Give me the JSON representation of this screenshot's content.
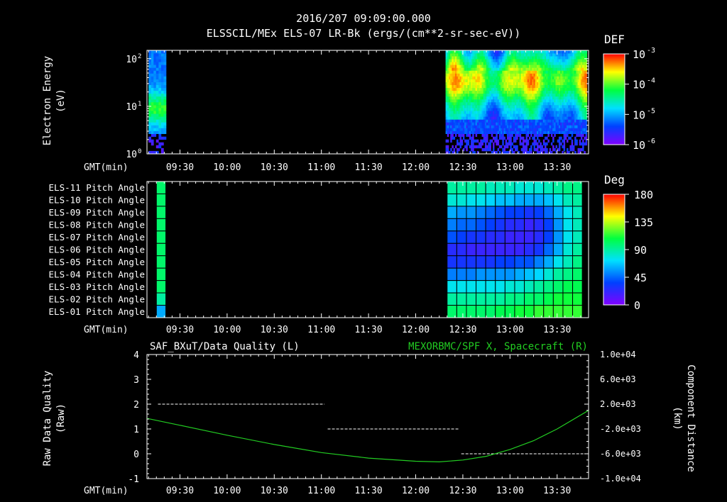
{
  "header": {
    "timestamp": "2016/207 09:09:00.000",
    "title": "ELSSCIL/MEx ELS-07 LR-Bk (ergs/(cm**2-sr-sec-eV))"
  },
  "colors": {
    "background": "#000000",
    "axis": "#ffffff",
    "spacecraft_trace": "#22cc22",
    "quality_trace": "#ffffff"
  },
  "chart_data": [
    {
      "type": "heatmap",
      "name": "electron-energy-spectrogram",
      "ylabel_lines": [
        "Electron Energy",
        "(eV)"
      ],
      "yscale": "log",
      "ylim": [
        1,
        150
      ],
      "ytick_labels": [
        {
          "value": 100,
          "base": "10",
          "exp": "2"
        },
        {
          "value": 10,
          "base": "10",
          "exp": "1"
        },
        {
          "value": 1,
          "base": "10",
          "exp": "0"
        }
      ],
      "x_label": "GMT(min)",
      "x_tick_labels": [
        "09:30",
        "10:00",
        "10:30",
        "11:00",
        "11:30",
        "12:00",
        "12:30",
        "13:00",
        "13:30"
      ],
      "x_tick_minutes": [
        570,
        600,
        630,
        660,
        690,
        720,
        750,
        780,
        810
      ],
      "xlim_minutes": [
        549,
        830
      ],
      "data_segments_minutes": [
        [
          550,
          560
        ],
        [
          739,
          829
        ]
      ],
      "colorbar": {
        "label": "DEF",
        "scale": "log",
        "range": [
          1e-06,
          0.001
        ],
        "tick_labels": [
          {
            "base": "10",
            "exp": "-3",
            "value": 0.001
          },
          {
            "base": "10",
            "exp": "-4",
            "value": 0.0001
          },
          {
            "base": "10",
            "exp": "-5",
            "value": 1e-05
          },
          {
            "base": "10",
            "exp": "-6",
            "value": 1e-06
          }
        ]
      }
    },
    {
      "type": "heatmap",
      "name": "pitch-angle-grid",
      "row_labels": [
        "ELS-11 Pitch Angle",
        "ELS-10 Pitch Angle",
        "ELS-09 Pitch Angle",
        "ELS-08 Pitch Angle",
        "ELS-07 Pitch Angle",
        "ELS-06 Pitch Angle",
        "ELS-05 Pitch Angle",
        "ELS-04 Pitch Angle",
        "ELS-03 Pitch Angle",
        "ELS-02 Pitch Angle",
        "ELS-01 Pitch Angle"
      ],
      "x_label": "GMT(min)",
      "x_tick_labels": [
        "09:30",
        "10:00",
        "10:30",
        "11:00",
        "11:30",
        "12:00",
        "12:30",
        "13:00",
        "13:30"
      ],
      "x_tick_minutes": [
        570,
        600,
        630,
        660,
        690,
        720,
        750,
        780,
        810
      ],
      "xlim_minutes": [
        549,
        830
      ],
      "early_column": {
        "start_minute": 555,
        "end_minute": 561,
        "values_deg": [
          100,
          100,
          100,
          100,
          100,
          100,
          100,
          100,
          100,
          90,
          60
        ]
      },
      "late_block": {
        "start_minute": 740,
        "end_minute": 826,
        "columns": 14,
        "values_deg": [
          [
            90,
            90,
            90,
            90,
            85,
            85,
            85,
            80,
            80,
            80,
            85,
            90,
            95,
            95
          ],
          [
            80,
            80,
            75,
            75,
            70,
            65,
            65,
            60,
            60,
            60,
            65,
            75,
            85,
            90
          ],
          [
            60,
            55,
            55,
            50,
            45,
            40,
            35,
            35,
            30,
            35,
            45,
            60,
            75,
            85
          ],
          [
            50,
            45,
            45,
            40,
            35,
            30,
            25,
            25,
            20,
            25,
            35,
            55,
            75,
            85
          ],
          [
            40,
            35,
            30,
            30,
            25,
            25,
            20,
            20,
            20,
            25,
            35,
            55,
            75,
            85
          ],
          [
            25,
            25,
            20,
            20,
            20,
            20,
            20,
            20,
            25,
            30,
            45,
            60,
            80,
            90
          ],
          [
            30,
            30,
            30,
            30,
            30,
            35,
            35,
            40,
            40,
            50,
            60,
            75,
            85,
            95
          ],
          [
            50,
            50,
            50,
            55,
            55,
            55,
            55,
            60,
            65,
            70,
            80,
            90,
            95,
            100
          ],
          [
            75,
            75,
            75,
            75,
            75,
            75,
            80,
            80,
            85,
            90,
            95,
            100,
            105,
            105
          ],
          [
            90,
            90,
            90,
            90,
            90,
            90,
            95,
            95,
            100,
            100,
            105,
            110,
            110,
            110
          ],
          [
            100,
            100,
            100,
            100,
            100,
            105,
            105,
            110,
            110,
            115,
            115,
            115,
            115,
            115
          ]
        ]
      },
      "colorbar": {
        "label": "Deg",
        "range": [
          0,
          180
        ],
        "tick_labels": [
          "180",
          "135",
          "90",
          "45",
          "0"
        ],
        "tick_values": [
          180,
          135,
          90,
          45,
          0
        ]
      }
    },
    {
      "type": "line",
      "name": "data-quality-and-spacecraft-position",
      "title_left": "SAF_BXuT/Data Quality (L)",
      "title_right": "MEXORBMC/SPF X, Spacecraft (R)",
      "ylabel_left_lines": [
        "Raw Data Quality",
        "(Raw)"
      ],
      "ylabel_right_lines": [
        "Component Distance",
        "(km)"
      ],
      "ylim_left": [
        -1,
        4
      ],
      "ytick_labels_left": [
        "4",
        "3",
        "2",
        "1",
        "0",
        "-1"
      ],
      "ytick_values_left": [
        4,
        3,
        2,
        1,
        0,
        -1
      ],
      "ylim_right": [
        -10000,
        10000
      ],
      "ytick_labels_right": [
        "1.0e+04",
        "6.0e+03",
        "2.0e+03",
        "-2.0e+03",
        "-6.0e+03",
        "-1.0e+04"
      ],
      "ytick_values_right": [
        10000,
        6000,
        2000,
        -2000,
        -6000,
        -10000
      ],
      "x_label": "GMT(min)",
      "x_tick_labels": [
        "09:30",
        "10:00",
        "10:30",
        "11:00",
        "11:30",
        "12:00",
        "12:30",
        "13:00",
        "13:30"
      ],
      "x_tick_minutes": [
        570,
        600,
        630,
        660,
        690,
        720,
        750,
        780,
        810
      ],
      "xlim_minutes": [
        549,
        830
      ],
      "series": [
        {
          "axis": "left",
          "style": "dashed",
          "segments": [
            {
              "x_minutes": [
                556,
                662
              ],
              "y": 2
            },
            {
              "x_minutes": [
                664,
                748
              ],
              "y": 1
            },
            {
              "x_minutes": [
                749,
                828
              ],
              "y": 0
            }
          ]
        },
        {
          "axis": "right",
          "style": "solid",
          "x_minutes": [
            549,
            570,
            600,
            630,
            660,
            690,
            720,
            735,
            750,
            765,
            780,
            795,
            810,
            830
          ],
          "y": [
            -300,
            -1400,
            -3000,
            -4500,
            -5800,
            -6700,
            -7200,
            -7300,
            -7000,
            -6400,
            -5300,
            -3900,
            -2000,
            1000
          ]
        }
      ]
    }
  ]
}
